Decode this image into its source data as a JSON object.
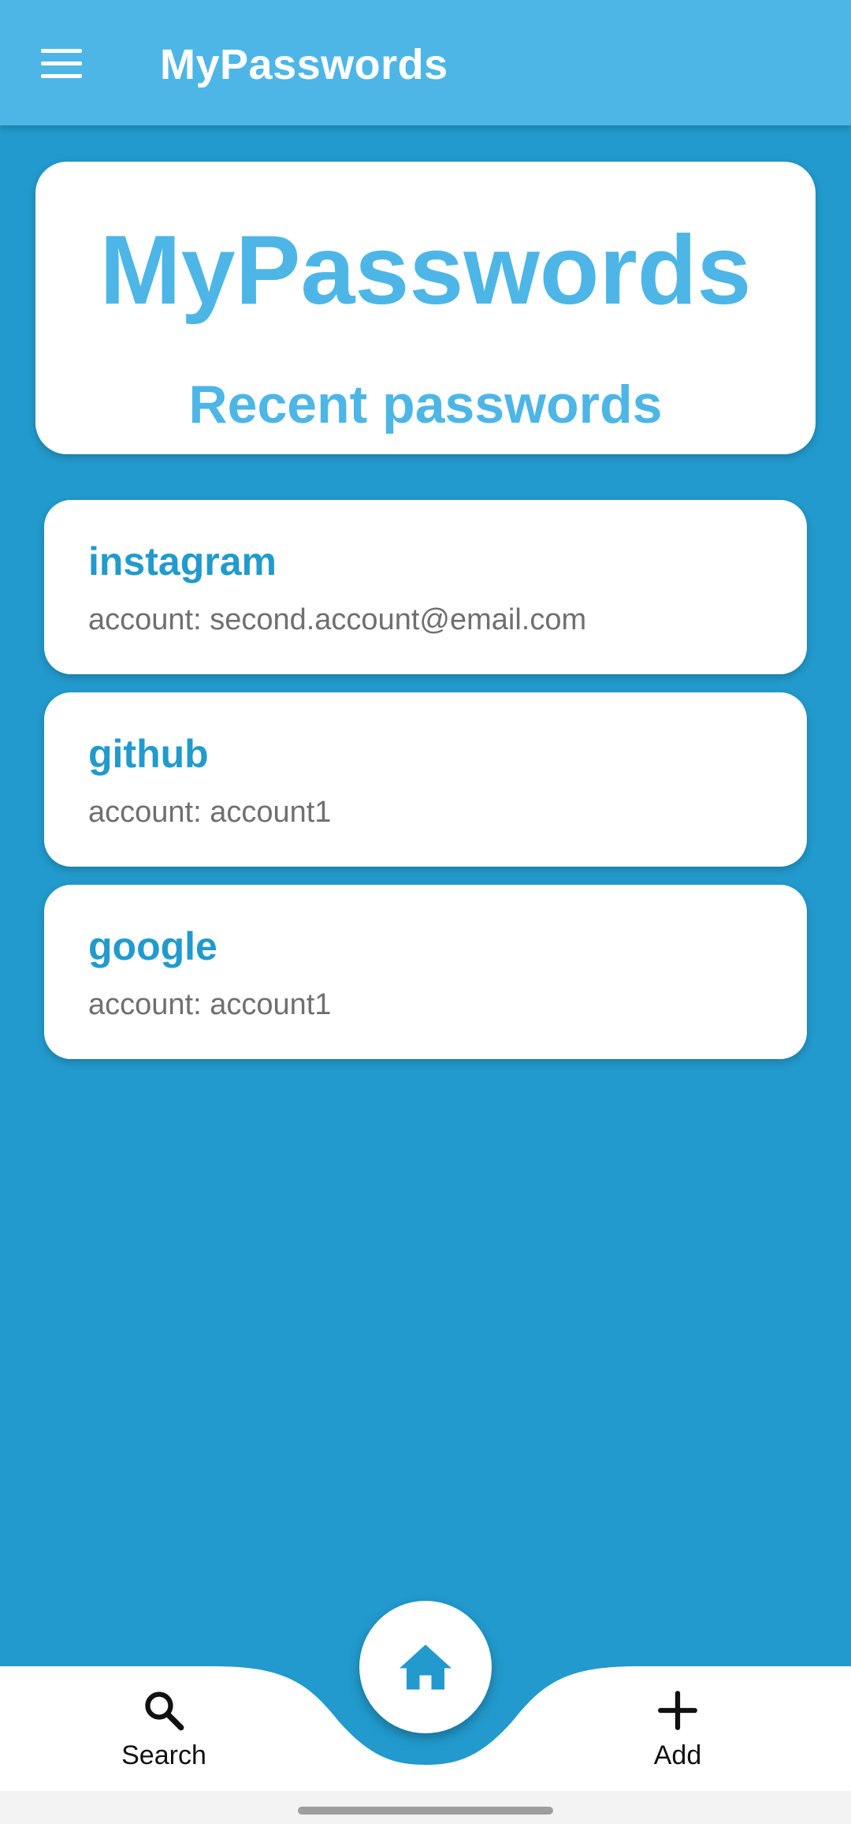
{
  "appbar": {
    "title": "MyPasswords",
    "menu_icon": "menu-icon"
  },
  "header_card": {
    "title": "MyPasswords",
    "subtitle": "Recent passwords"
  },
  "passwords": [
    {
      "name": "instagram",
      "account": "account: second.account@email.com"
    },
    {
      "name": "github",
      "account": "account: account1"
    },
    {
      "name": "google",
      "account": "account: account1"
    }
  ],
  "bottom_nav": {
    "search_label": "Search",
    "search_icon": "search-icon",
    "home_icon": "home-icon",
    "add_label": "Add",
    "add_icon": "plus-icon"
  },
  "colors": {
    "appbar": "#4db6e6",
    "background": "#229acd",
    "accent_text": "#4db6e6",
    "card_title": "#229acd"
  }
}
